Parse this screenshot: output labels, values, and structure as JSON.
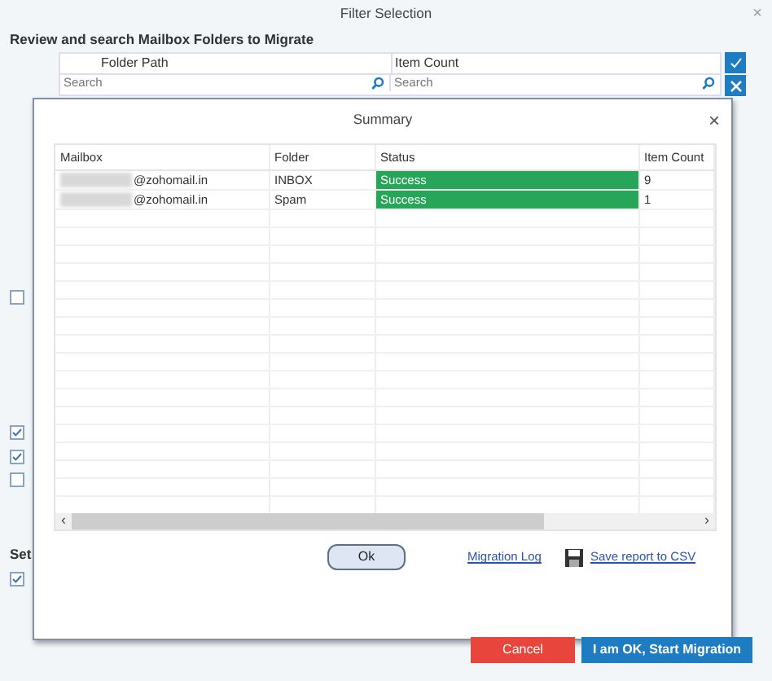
{
  "window": {
    "title": "Filter Selection",
    "close": "×"
  },
  "heading": "Review and search Mailbox Folders to Migrate",
  "folder_grid": {
    "columns": [
      "Folder Path",
      "Item Count"
    ],
    "search_placeholders": [
      "Search",
      "Search"
    ]
  },
  "options": [
    {
      "checked": false
    },
    {
      "checked": true
    },
    {
      "checked": true
    },
    {
      "checked": false
    }
  ],
  "settings": {
    "heading": "Set",
    "options": [
      {
        "checked": true
      }
    ]
  },
  "summary_dialog": {
    "title": "Summary",
    "close": "×",
    "columns": [
      "Mailbox",
      "Folder",
      "Status",
      "Item Count"
    ],
    "rows": [
      {
        "mailbox": "@zohomail.in",
        "mailbox_redacted": true,
        "folder": "INBOX",
        "status": "Success",
        "status_ok": true,
        "item_count": "9"
      },
      {
        "mailbox": "@zohomail.in",
        "mailbox_redacted": true,
        "folder": "Spam",
        "status": "Success",
        "status_ok": true,
        "item_count": "1"
      }
    ],
    "scroll_left": "‹",
    "scroll_right": "›",
    "ok_button": "Ok",
    "links": [
      "Migration Log",
      "Save report to CSV"
    ]
  },
  "buttons": [
    {
      "label": "Cancel",
      "kind": "danger"
    },
    {
      "label": "I am OK, Start Migration",
      "kind": "primary"
    }
  ]
}
